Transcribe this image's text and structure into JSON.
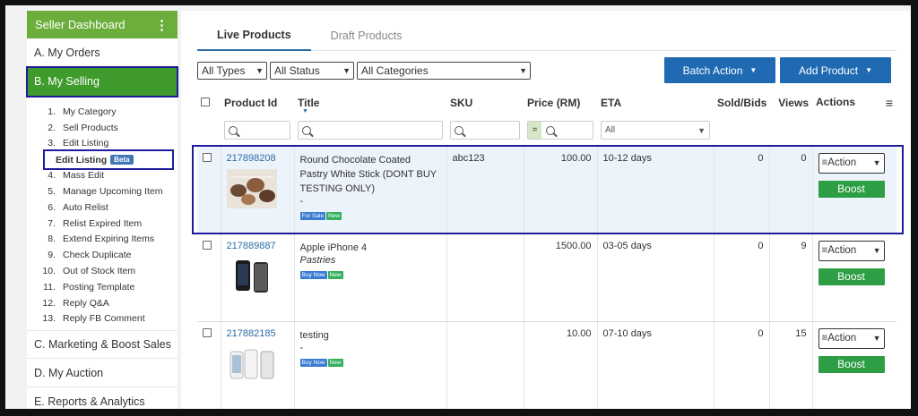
{
  "sidebar": {
    "header": "Seller Dashboard",
    "items": [
      {
        "label": "A. My Orders"
      },
      {
        "label": "B. My Selling"
      },
      {
        "label": "C. Marketing & Boost Sales"
      },
      {
        "label": "D. My Auction"
      },
      {
        "label": "E. Reports & Analytics"
      }
    ],
    "sub_items": [
      {
        "num": "1.",
        "label": "My Category"
      },
      {
        "num": "2.",
        "label": "Sell Products"
      },
      {
        "num": "3.",
        "label": "Edit Listing"
      },
      {
        "num": "",
        "label": "Edit Listing"
      },
      {
        "num": "4.",
        "label": "Mass Edit"
      },
      {
        "num": "5.",
        "label": "Manage Upcoming Item"
      },
      {
        "num": "6.",
        "label": "Auto Relist"
      },
      {
        "num": "7.",
        "label": "Relist Expired Item"
      },
      {
        "num": "8.",
        "label": "Extend Expiring Items"
      },
      {
        "num": "9.",
        "label": "Check Duplicate"
      },
      {
        "num": "10.",
        "label": "Out of Stock Item"
      },
      {
        "num": "11.",
        "label": "Posting Template"
      },
      {
        "num": "12.",
        "label": "Reply Q&A"
      },
      {
        "num": "13.",
        "label": "Reply FB Comment"
      }
    ],
    "beta_badge": "Beta"
  },
  "tabs": [
    {
      "label": "Live Products",
      "active": true
    },
    {
      "label": "Draft Products",
      "active": false
    }
  ],
  "filters": {
    "types": "All Types",
    "status": "All Status",
    "categories": "All Categories"
  },
  "buttons": {
    "batch_action": "Batch Action",
    "add_product": "Add Product"
  },
  "columns": [
    "Product Id",
    "Title",
    "SKU",
    "Price (RM)",
    "ETA",
    "Sold/Bids",
    "Views",
    "Actions"
  ],
  "eta_filter": "All",
  "price_filter_op": "=",
  "products": [
    {
      "id": "217898208",
      "title": "Round Chocolate Coated Pastry White Stick (DONT BUY TESTING ONLY)",
      "subtitle": "-",
      "sku": "abc123",
      "price": "100.00",
      "eta": "10-12 days",
      "sold": "0",
      "views": "0",
      "tags": [
        "For Sale",
        "New"
      ],
      "action": "Action",
      "boost": "Boost"
    },
    {
      "id": "217889887",
      "title": "Apple iPhone 4",
      "subtitle": "Pastries",
      "sku": "",
      "price": "1500.00",
      "eta": "03-05 days",
      "sold": "0",
      "views": "9",
      "tags": [
        "Buy Now",
        "New"
      ],
      "action": "Action",
      "boost": "Boost"
    },
    {
      "id": "217882185",
      "title": "testing",
      "subtitle": "-",
      "sku": "",
      "price": "10.00",
      "eta": "07-10 days",
      "sold": "0",
      "views": "15",
      "tags": [
        "Buy Now",
        "New"
      ],
      "action": "Action",
      "boost": "Boost"
    }
  ],
  "colors": {
    "accent": "#1f6ab2",
    "sidebar_header": "#6cae3c",
    "active": "#3f9b2b",
    "boost": "#2e9e45",
    "highlight_border": "#1d1d9c"
  }
}
